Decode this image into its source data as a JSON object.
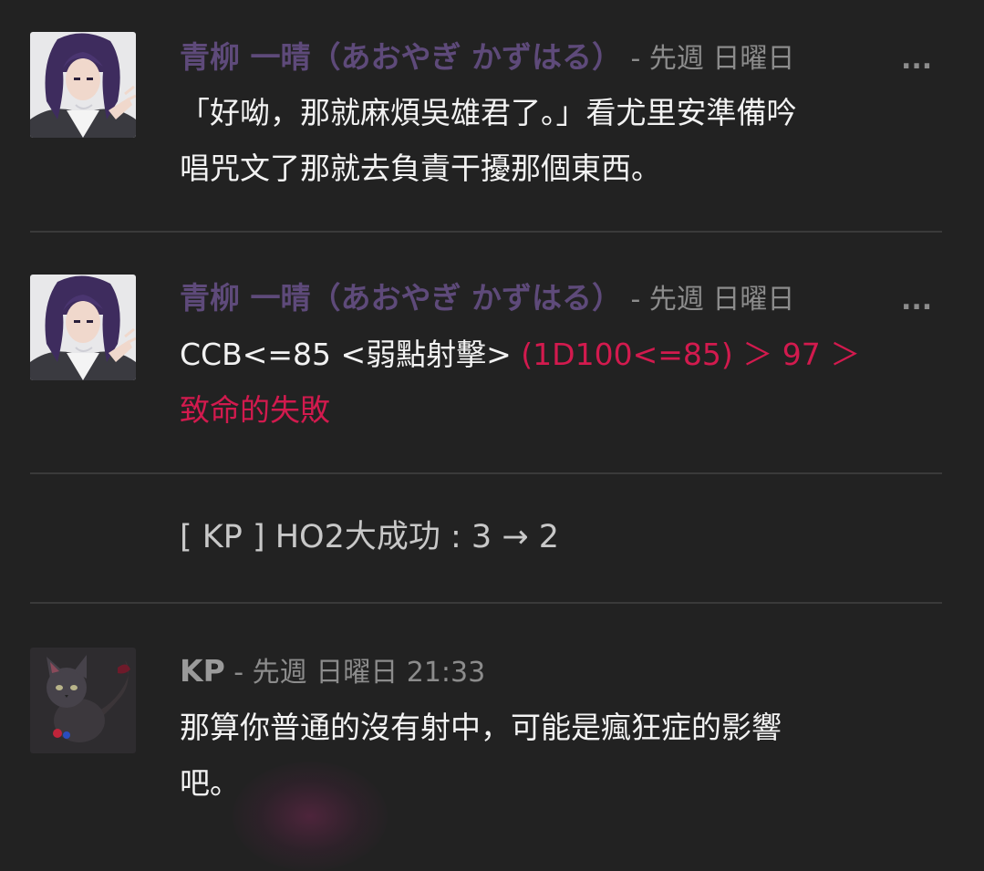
{
  "messages": [
    {
      "author": "青柳 一晴（あおやぎ かずはる）",
      "separator": " - ",
      "timestamp": "先週 日曜日",
      "ellipsis": "...",
      "line1": "「好呦，那就麻煩吳雄君了。」看尤里安準備吟",
      "line2": "唱咒文了那就去負責干擾那個東西。"
    },
    {
      "author": "青柳 一晴（あおやぎ かずはる）",
      "separator": " - ",
      "timestamp": "先週 日曜日",
      "ellipsis": "...",
      "command": "CCB<=85 <弱點射擊> ",
      "result_line1": "(1D100<=85) ＞ 97 ＞",
      "result_line2": "致命的失敗"
    },
    {
      "system_text": "[ KP ] HO2大成功 : 3 → 2"
    },
    {
      "author": "KP",
      "separator": " - ",
      "timestamp": "先週 日曜日 21:33",
      "line1": "那算你普通的沒有射中，可能是瘋狂症的影響",
      "line2": "吧。"
    }
  ],
  "colors": {
    "background": "#222222",
    "author_aoyagi": "#5e4a7a",
    "author_kp": "#9a9a9a",
    "timestamp": "#8c8c8c",
    "body_text": "#f2f2f2",
    "dice_result": "#d21a4e",
    "divider": "#3a3a3a"
  },
  "icons": {
    "aoyagi_avatar": "purple-haired-character-avatar",
    "kp_avatar": "black-cat-with-dice-avatar"
  }
}
